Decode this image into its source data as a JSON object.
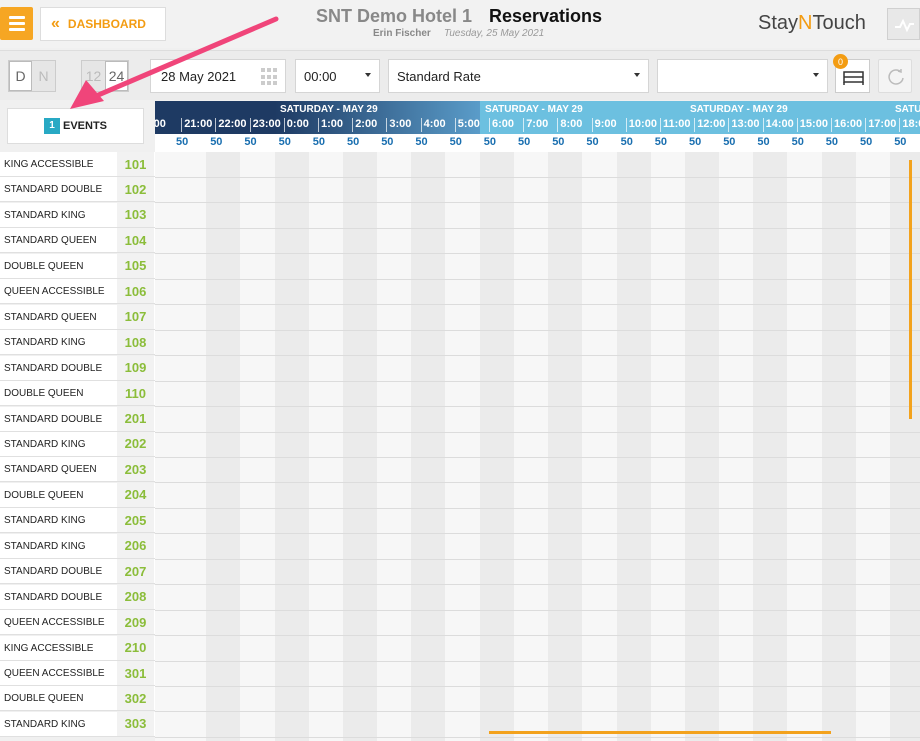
{
  "header": {
    "dashboard_label": "DASHBOARD",
    "hotel_name": "SNT Demo Hotel 1",
    "page_title": "Reservations",
    "user_name": "Erin Fischer",
    "current_date": "Tuesday, 25 May 2021",
    "logo_left": "Stay",
    "logo_mid": "N",
    "logo_right": "Touch"
  },
  "toolbar": {
    "view_mode": {
      "left": "D",
      "right": "N"
    },
    "hour_mode": {
      "left": "12",
      "right": "24"
    },
    "date_value": "28 May 2021",
    "time_value": "00:00",
    "rate_value": "Standard Rate",
    "room_type_value": "",
    "unassigned_count": "0"
  },
  "events": {
    "count": "1",
    "label": "EVENTS"
  },
  "timeline": {
    "day_labels": [
      "SATURDAY - MAY 29",
      "SATURDAY - MAY 29",
      "SATURDAY - MAY 29",
      "SATU"
    ],
    "hours": [
      ":00",
      "21:00",
      "22:00",
      "23:00",
      "0:00",
      "1:00",
      "2:00",
      "3:00",
      "4:00",
      "5:00",
      "6:00",
      "7:00",
      "8:00",
      "9:00",
      "10:00",
      "11:00",
      "12:00",
      "13:00",
      "14:00",
      "15:00",
      "16:00",
      "17:00",
      "18:00"
    ],
    "rates": [
      "50",
      "50",
      "50",
      "50",
      "50",
      "50",
      "50",
      "50",
      "50",
      "50",
      "50",
      "50",
      "50",
      "50",
      "50",
      "50",
      "50",
      "50",
      "50",
      "50",
      "50",
      "50",
      "50"
    ]
  },
  "rooms": [
    {
      "type": "KING ACCESSIBLE",
      "number": "101"
    },
    {
      "type": "STANDARD DOUBLE",
      "number": "102"
    },
    {
      "type": "STANDARD KING",
      "number": "103"
    },
    {
      "type": "STANDARD QUEEN",
      "number": "104"
    },
    {
      "type": "DOUBLE QUEEN",
      "number": "105"
    },
    {
      "type": "QUEEN ACCESSIBLE",
      "number": "106"
    },
    {
      "type": "STANDARD QUEEN",
      "number": "107"
    },
    {
      "type": "STANDARD KING",
      "number": "108"
    },
    {
      "type": "STANDARD DOUBLE",
      "number": "109"
    },
    {
      "type": "DOUBLE QUEEN",
      "number": "110"
    },
    {
      "type": "STANDARD DOUBLE",
      "number": "201"
    },
    {
      "type": "STANDARD KING",
      "number": "202"
    },
    {
      "type": "STANDARD QUEEN",
      "number": "203"
    },
    {
      "type": "DOUBLE QUEEN",
      "number": "204"
    },
    {
      "type": "STANDARD KING",
      "number": "205"
    },
    {
      "type": "STANDARD KING",
      "number": "206"
    },
    {
      "type": "STANDARD DOUBLE",
      "number": "207"
    },
    {
      "type": "STANDARD DOUBLE",
      "number": "208"
    },
    {
      "type": "QUEEN ACCESSIBLE",
      "number": "209"
    },
    {
      "type": "KING ACCESSIBLE",
      "number": "210"
    },
    {
      "type": "QUEEN ACCESSIBLE",
      "number": "301"
    },
    {
      "type": "DOUBLE QUEEN",
      "number": "302"
    },
    {
      "type": "STANDARD KING",
      "number": "303"
    }
  ],
  "colors": {
    "accent": "#f39c12",
    "room_number": "#8bbd3a",
    "events_badge": "#28a9c4",
    "band_night": "#1e3a63",
    "band_day": "#6cc0e0",
    "rate_text": "#1a6fb0",
    "annotation_arrow": "#f0457a"
  },
  "icons": {
    "menu": "hamburger-icon",
    "back": "double-chevron-left-icon",
    "activity": "activity-line-icon",
    "calendar": "grid-calendar-icon",
    "bed": "bed-icon",
    "refresh": "refresh-icon",
    "arrow": "annotation-arrow-icon"
  }
}
